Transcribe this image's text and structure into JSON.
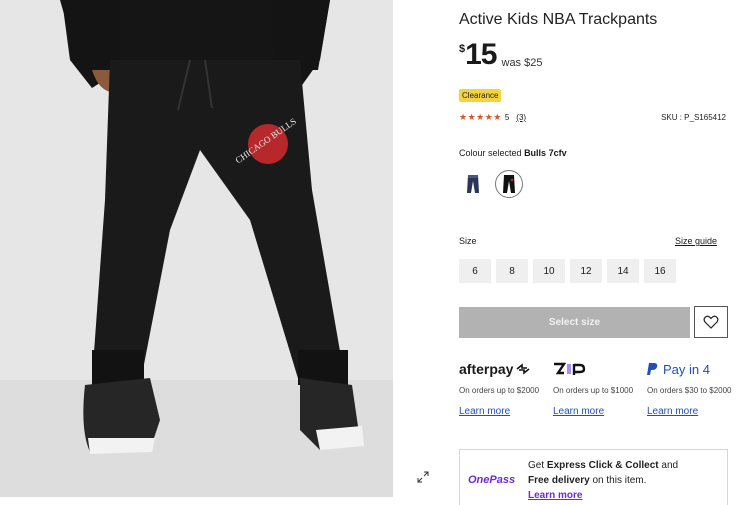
{
  "product": {
    "title": "Active Kids NBA Trackpants",
    "currency": "$",
    "price": "15",
    "was_price": "was $25",
    "badge": "Clearance",
    "rating_stars": "★★★★★",
    "rating_score": "5",
    "review_count": "(3)",
    "sku": "SKU : P_S165412",
    "jersey_text": "CHICAGO BULLS"
  },
  "colour": {
    "label": "Colour selected",
    "selected": "Bulls 7cfv"
  },
  "size": {
    "label": "Size",
    "guide_label": "Size guide",
    "options": [
      "6",
      "8",
      "10",
      "12",
      "14",
      "16"
    ]
  },
  "actions": {
    "select_size": "Select size"
  },
  "payments": {
    "afterpay": {
      "logo_text": "afterpay",
      "desc": "On orders up to $2000",
      "learn": "Learn more"
    },
    "zip": {
      "logo_text": "zip",
      "desc": "On orders up to $1000",
      "learn": "Learn more"
    },
    "paypal": {
      "logo_text": "Pay in 4",
      "desc": "On orders $30 to $2000",
      "learn": "Learn more"
    }
  },
  "onepass": {
    "logo": "OnePass",
    "text_prefix": "Get ",
    "text_bold1": "Express Click & Collect",
    "text_mid": " and",
    "text_bold2": "Free delivery",
    "text_suffix": " on this item.",
    "learn": "Learn more"
  },
  "colors": {
    "badge": "#f5d33c",
    "stars": "#d0592b",
    "link": "#1f4fbf",
    "onepass": "#6b2bd9",
    "paypal": "#1f4fbf",
    "select_size_bg": "#b2b2b2"
  },
  "icons": {
    "expand": "expand-icon",
    "wishlist": "heart-icon",
    "paypal": "paypal-icon"
  }
}
